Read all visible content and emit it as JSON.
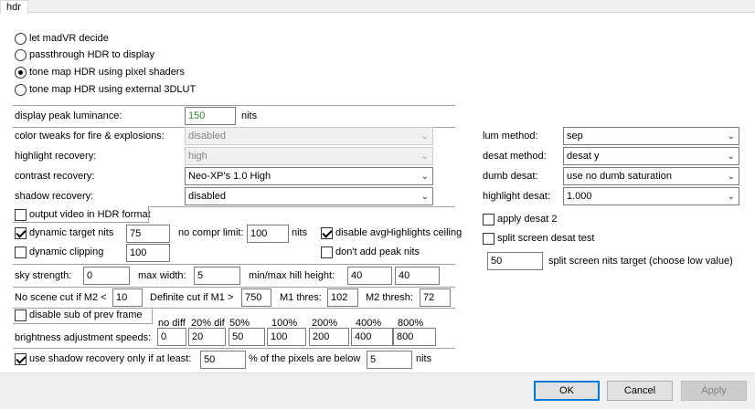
{
  "tab": "hdr",
  "mode_options": [
    {
      "label": "let madVR decide",
      "selected": false
    },
    {
      "label": "passthrough HDR to display",
      "selected": false
    },
    {
      "label": "tone map HDR using pixel shaders",
      "selected": true
    },
    {
      "label": "tone map HDR using external 3DLUT",
      "selected": false
    }
  ],
  "peak": {
    "label": "display peak luminance:",
    "value": "150",
    "unit": "nits"
  },
  "tweaks": [
    {
      "label": "color tweaks for fire & explosions:",
      "value": "disabled",
      "disabled": true
    },
    {
      "label": "highlight recovery:",
      "value": "high",
      "disabled": true
    },
    {
      "label": "contrast recovery:",
      "value": "Neo-XP's 1.0 High",
      "disabled": false
    },
    {
      "label": "shadow recovery:",
      "value": "disabled",
      "disabled": false
    }
  ],
  "output_hdr": {
    "label": "output video in HDR format",
    "checked": false
  },
  "dynamic_target": {
    "label": "dynamic target nits",
    "checked": true,
    "value": "75"
  },
  "no_compr": {
    "label": "no compr limit:",
    "value": "100",
    "unit": "nits"
  },
  "disable_avg": {
    "label": "disable avgHighlights ceiling",
    "checked": true
  },
  "dynamic_clipping": {
    "label": "dynamic clipping",
    "checked": false,
    "value": "100"
  },
  "dont_add_peak": {
    "label": "don't add peak nits",
    "checked": false
  },
  "sky": {
    "label": "sky strength:",
    "value": "0"
  },
  "max_width": {
    "label": "max width:",
    "value": "5"
  },
  "hill": {
    "label": "min/max hill height:",
    "min": "40",
    "max": "40"
  },
  "scene_cut": {
    "label": "No scene cut if M2 <",
    "value": "10"
  },
  "def_cut": {
    "label": "Definite cut if M1 >",
    "value": "750"
  },
  "m1": {
    "label": "M1 thres:",
    "value": "102"
  },
  "m2": {
    "label": "M2 thresh:",
    "value": "72"
  },
  "disable_sub": {
    "label": "disable sub of prev frame",
    "checked": false
  },
  "speeds": {
    "label": "brightness adjustment speeds:",
    "headers": [
      "no diff",
      "20% dif",
      "50%",
      "100%",
      "200%",
      "400%",
      "800%"
    ],
    "values": [
      "0",
      "20",
      "50",
      "100",
      "200",
      "400",
      "800"
    ]
  },
  "shadow_only": {
    "label": "use shadow recovery only if at least:",
    "checked": true,
    "value": "50",
    "mid": "% of the pixels are below",
    "nits": "5",
    "unit": "nits"
  },
  "right": {
    "lum_method": {
      "label": "lum method:",
      "value": "sep"
    },
    "desat_method": {
      "label": "desat method:",
      "value": "desat y"
    },
    "dumb_desat": {
      "label": "dumb desat:",
      "value": "use no dumb saturation"
    },
    "highlight_desat": {
      "label": "highlight desat:",
      "value": "1.000"
    },
    "apply_desat2": {
      "label": "apply desat 2",
      "checked": false
    },
    "split_test": {
      "label": "split screen desat test",
      "checked": false
    },
    "split_nits": {
      "value": "50",
      "label": "split screen nits target (choose low value)"
    }
  },
  "buttons": {
    "ok": "OK",
    "cancel": "Cancel",
    "apply": "Apply"
  }
}
